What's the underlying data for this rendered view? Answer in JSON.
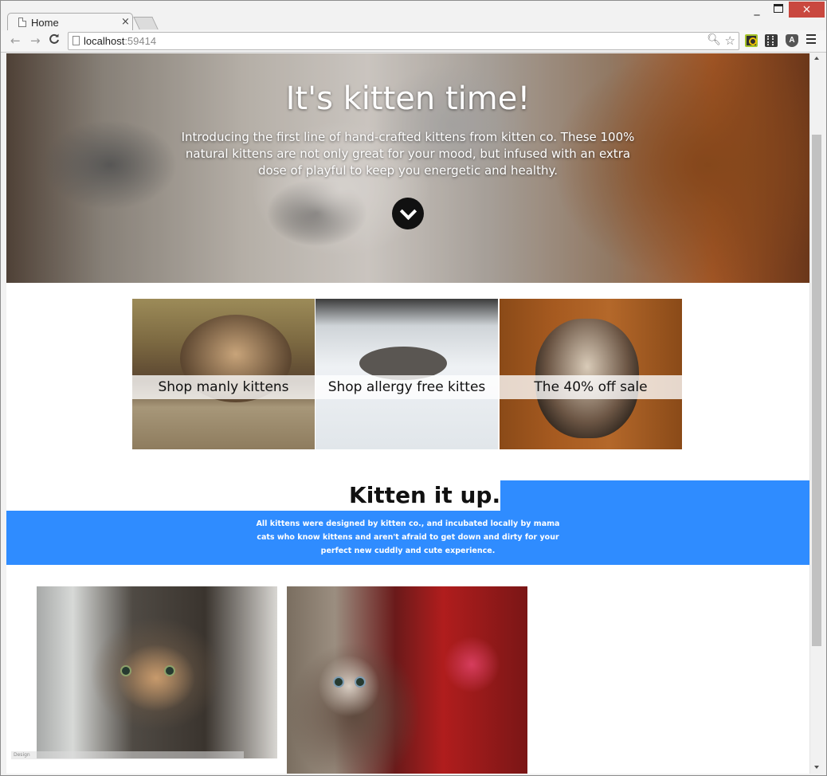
{
  "browser": {
    "tab_title": "Home",
    "tab_close": "×",
    "url_host": "localhost",
    "url_port": ":59414",
    "nav": {
      "back": "←",
      "forward": "→",
      "reload": "C"
    },
    "window": {
      "minimize": "_",
      "close": "×"
    },
    "icons": [
      "page-icon",
      "zoom-icon",
      "star-icon",
      "extension-icon",
      "menu-icon"
    ]
  },
  "hero": {
    "title": "It's kitten time!",
    "text": "Introducing the first line of hand-crafted kittens from kitten co. These 100% natural kittens are not only great for your mood, but infused with an extra dose of playful to keep you energetic and healthy."
  },
  "tiles": [
    {
      "label": "Shop manly kittens"
    },
    {
      "label": "Shop allergy free kittes"
    },
    {
      "label": "The 40% off sale"
    }
  ],
  "section": {
    "title": "Kitten it up.",
    "text": "All kittens were designed by kitten co., and incubated locally by mama cats who know kittens and aren't afraid to get down and dirty for your perfect new cuddly and cute experience.",
    "accent_color": "#2f8cff"
  },
  "footer_overlay": {
    "text": "Design"
  }
}
